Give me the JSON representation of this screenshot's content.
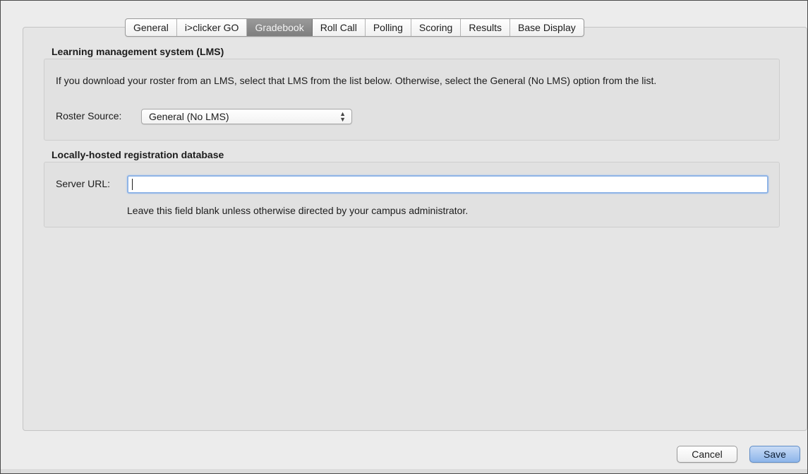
{
  "tabs": {
    "items": [
      {
        "label": "General"
      },
      {
        "label": "i>clicker GO"
      },
      {
        "label": "Gradebook"
      },
      {
        "label": "Roll Call"
      },
      {
        "label": "Polling"
      },
      {
        "label": "Scoring"
      },
      {
        "label": "Results"
      },
      {
        "label": "Base Display"
      }
    ],
    "selected": "Gradebook"
  },
  "lms_section": {
    "title": "Learning management system (LMS)",
    "description": "If you download your roster from an LMS, select that LMS from the list below. Otherwise, select the General (No LMS) option from the list.",
    "roster_source_label": "Roster Source:",
    "roster_source_value": "General (No LMS)"
  },
  "registration_section": {
    "title": "Locally-hosted registration database",
    "server_url_label": "Server URL:",
    "server_url_value": "",
    "helper": "Leave this field blank unless otherwise directed by your campus administrator."
  },
  "buttons": {
    "cancel_label": "Cancel",
    "save_label": "Save"
  },
  "colors": {
    "selected_tab": "#8a8a8a",
    "focus_ring": "#8fb4e6",
    "default_button": "#8db5ea"
  }
}
